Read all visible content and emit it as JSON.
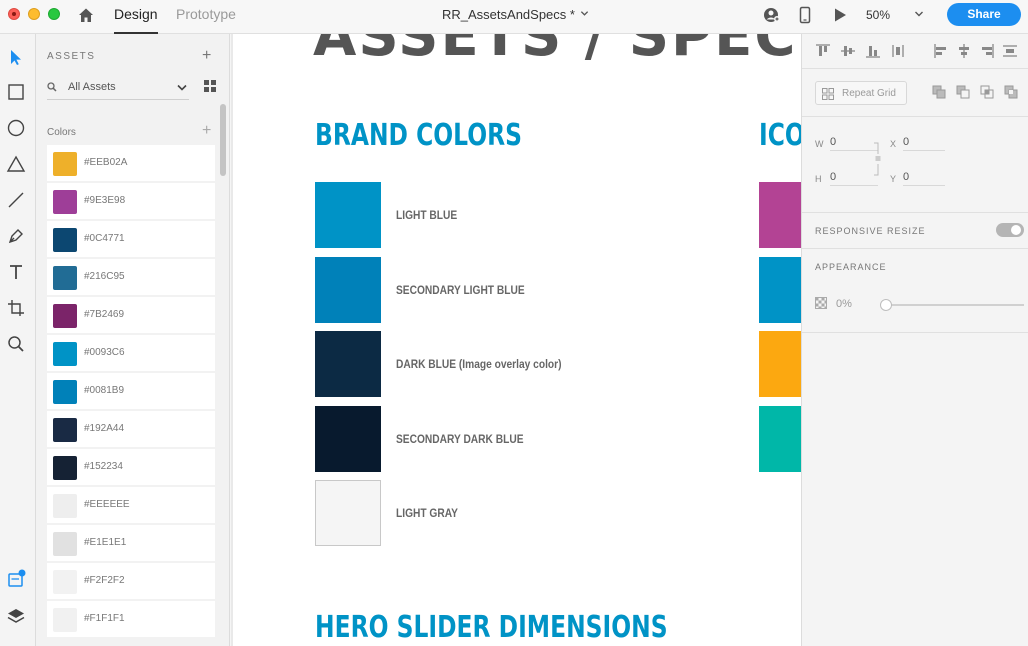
{
  "titlebar": {
    "tabs": [
      {
        "label": "Design",
        "active": true
      },
      {
        "label": "Prototype",
        "active": false
      }
    ],
    "document_title": "RR_AssetsAndSpecs *",
    "zoom": "50%",
    "share_label": "Share",
    "icons": [
      "home-icon",
      "user-icon",
      "device-preview-icon",
      "play-icon"
    ]
  },
  "toolbar": {
    "tools": [
      "select-tool",
      "rectangle-tool",
      "ellipse-tool",
      "polygon-tool",
      "line-tool",
      "pen-tool",
      "text-tool",
      "artboard-tool",
      "zoom-tool"
    ],
    "bottom": [
      "assets-panel-icon",
      "layers-icon"
    ]
  },
  "assets": {
    "title": "ASSETS",
    "search_value": "All Assets",
    "colors_title": "Colors",
    "colors": [
      {
        "label": "#EEB02A",
        "hex": "#EEB02A"
      },
      {
        "label": "#9E3E98",
        "hex": "#9E3E98"
      },
      {
        "label": "#0C4771",
        "hex": "#0C4771"
      },
      {
        "label": "#216C95",
        "hex": "#216C95"
      },
      {
        "label": "#7B2469",
        "hex": "#7B2469"
      },
      {
        "label": "#0093C6",
        "hex": "#0093C6"
      },
      {
        "label": "#0081B9",
        "hex": "#0081B9"
      },
      {
        "label": "#192A44",
        "hex": "#192A44"
      },
      {
        "label": "#152234",
        "hex": "#152234"
      },
      {
        "label": "#EEEEEE",
        "hex": "#EEEEEE"
      },
      {
        "label": "#E1E1E1",
        "hex": "#E1E1E1"
      },
      {
        "label": "#F2F2F2",
        "hex": "#F2F2F2"
      },
      {
        "label": "#F1F1F1",
        "hex": "#F1F1F1"
      }
    ]
  },
  "canvas": {
    "brand_title": "BRAND COLORS",
    "icon_title_partial": "ICO",
    "hero_title": "HERO SLIDER DIMENSIONS",
    "brand_colors": [
      {
        "label": "LIGHT BLUE",
        "hex": "#0093c6"
      },
      {
        "label": "SECONDARY LIGHT BLUE",
        "hex": "#0081b9"
      },
      {
        "label": "DARK BLUE (Image overlay color)",
        "hex": "#0c2a44"
      },
      {
        "label": "SECONDARY DARK BLUE",
        "hex": "#081a2e"
      },
      {
        "label": "LIGHT GRAY",
        "hex": "#f5f5f5"
      }
    ],
    "icon_colors": [
      {
        "hex": "#b34394"
      },
      {
        "hex": "#0093c6"
      },
      {
        "hex": "#fca810"
      },
      {
        "hex": "#00b7a8"
      }
    ]
  },
  "properties": {
    "repeat_grid_label": "Repeat Grid",
    "w_label": "W",
    "w_value": "0",
    "h_label": "H",
    "h_value": "0",
    "x_label": "X",
    "x_value": "0",
    "y_label": "Y",
    "y_value": "0",
    "responsive_resize_label": "RESPONSIVE RESIZE",
    "appearance_label": "APPEARANCE",
    "opacity_value": "0%",
    "opacity_fraction": 0
  },
  "colors": {
    "accent": "#1c8ef0",
    "brand_blue": "#0093c6"
  }
}
